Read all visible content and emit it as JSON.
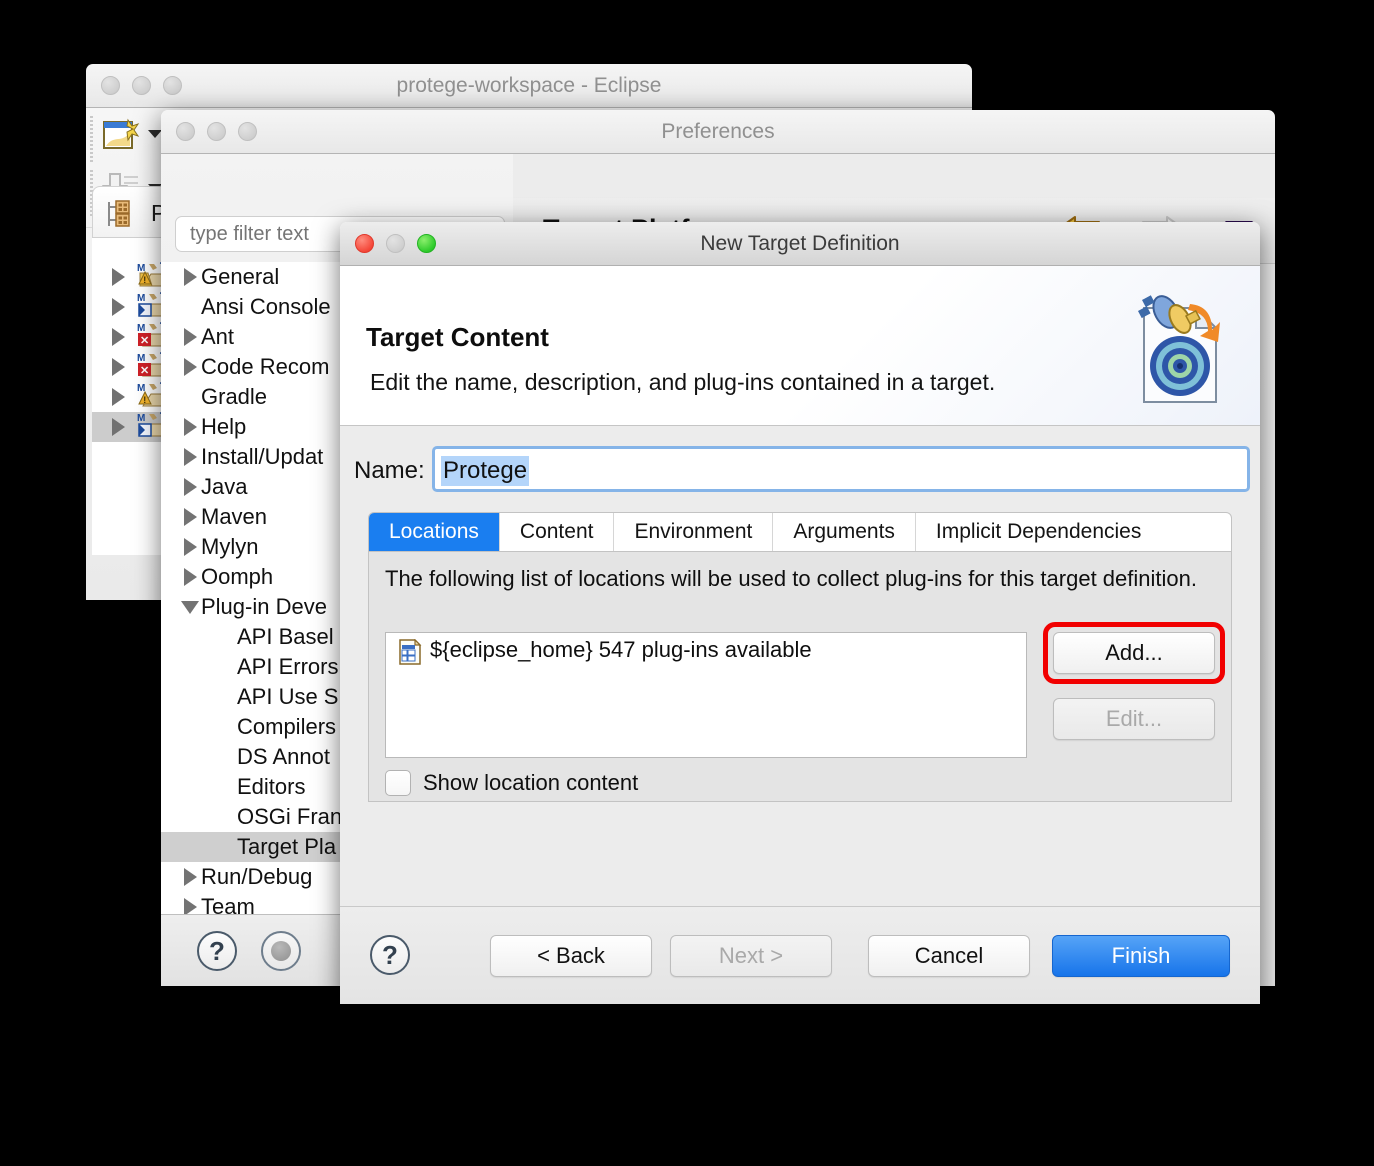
{
  "eclipse_window": {
    "title": "protege-workspace - Eclipse",
    "traffic_lights": [
      "close-gray",
      "minimize-gray",
      "zoom-gray"
    ],
    "toolbar": {
      "new_wizard_icon": "new-wizard-icon",
      "new_wizard_caret": "▼",
      "save_icon": "save-icon",
      "save_caret": "▼"
    },
    "package_explorer": {
      "tab_label": "Pa",
      "tab_icon": "package-explorer-icon",
      "rows": [
        {
          "expander": "▶",
          "icon": "maven-project-warning-icon",
          "selected": false
        },
        {
          "expander": "▶",
          "icon": "maven-project-icon",
          "selected": false
        },
        {
          "expander": "▶",
          "icon": "maven-project-error-icon",
          "selected": false
        },
        {
          "expander": "▶",
          "icon": "maven-project-error-icon",
          "selected": false
        },
        {
          "expander": "▶",
          "icon": "maven-project-warning-icon",
          "selected": false
        },
        {
          "expander": "▶",
          "icon": "maven-project-icon",
          "selected": true
        }
      ]
    }
  },
  "preferences_window": {
    "title": "Preferences",
    "traffic_lights": [
      "close-gray",
      "minimize-gray",
      "zoom-gray"
    ],
    "filter": {
      "placeholder": "type filter text",
      "value": ""
    },
    "tree_items": [
      {
        "label": "General",
        "arrow": "collapsed",
        "indent": 0,
        "selected": false
      },
      {
        "label": "Ansi Console",
        "arrow": "none",
        "indent": 0,
        "selected": false
      },
      {
        "label": "Ant",
        "arrow": "collapsed",
        "indent": 0,
        "selected": false
      },
      {
        "label": "Code Recom",
        "arrow": "collapsed",
        "indent": 0,
        "selected": false
      },
      {
        "label": "Gradle",
        "arrow": "none",
        "indent": 0,
        "selected": false
      },
      {
        "label": "Help",
        "arrow": "collapsed",
        "indent": 0,
        "selected": false
      },
      {
        "label": "Install/Updat",
        "arrow": "collapsed",
        "indent": 0,
        "selected": false
      },
      {
        "label": "Java",
        "arrow": "collapsed",
        "indent": 0,
        "selected": false
      },
      {
        "label": "Maven",
        "arrow": "collapsed",
        "indent": 0,
        "selected": false
      },
      {
        "label": "Mylyn",
        "arrow": "collapsed",
        "indent": 0,
        "selected": false
      },
      {
        "label": "Oomph",
        "arrow": "collapsed",
        "indent": 0,
        "selected": false
      },
      {
        "label": "Plug-in Deve",
        "arrow": "expanded",
        "indent": 0,
        "selected": false
      },
      {
        "label": "API Basel",
        "arrow": "none",
        "indent": 1,
        "selected": false
      },
      {
        "label": "API Errors",
        "arrow": "none",
        "indent": 1,
        "selected": false
      },
      {
        "label": "API Use S",
        "arrow": "none",
        "indent": 1,
        "selected": false
      },
      {
        "label": "Compilers",
        "arrow": "none",
        "indent": 1,
        "selected": false
      },
      {
        "label": "DS Annot",
        "arrow": "none",
        "indent": 1,
        "selected": false
      },
      {
        "label": "Editors",
        "arrow": "none",
        "indent": 1,
        "selected": false
      },
      {
        "label": "OSGi Fran",
        "arrow": "none",
        "indent": 1,
        "selected": false
      },
      {
        "label": "Target Pla",
        "arrow": "none",
        "indent": 1,
        "selected": true
      },
      {
        "label": "Run/Debug",
        "arrow": "collapsed",
        "indent": 0,
        "selected": false
      },
      {
        "label": "Team",
        "arrow": "collapsed",
        "indent": 0,
        "selected": false
      }
    ],
    "page_title": "Target Platform",
    "nav": {
      "back_icon": "back-arrow-icon",
      "back_caret": "▼",
      "forward_icon": "forward-arrow-icon",
      "forward_caret": "▼",
      "menu_caret": "▼"
    },
    "footer": {
      "help_icon": "help-question-icon",
      "record_icon": "record-circle-icon"
    }
  },
  "new_target_definition": {
    "title": "New Target Definition",
    "traffic_lights": [
      "close-red",
      "minimize-gray",
      "zoom-green"
    ],
    "header": {
      "heading": "Target Content",
      "subheading": "Edit the name, description, and plug-ins contained in a target.",
      "icon": "target-definition-icon"
    },
    "name": {
      "label": "Name:",
      "value": "Protege",
      "selected": true
    },
    "tabs": [
      {
        "label": "Locations",
        "active": true
      },
      {
        "label": "Content",
        "active": false
      },
      {
        "label": "Environment",
        "active": false
      },
      {
        "label": "Arguments",
        "active": false
      },
      {
        "label": "Implicit Dependencies",
        "active": false
      }
    ],
    "locations_panel": {
      "description": "The following list of locations will be used to collect plug-ins for this target definition.",
      "items": [
        {
          "icon": "eclipse-home-location-icon",
          "label": "${eclipse_home} 547 plug-ins available"
        }
      ],
      "add_button": "Add...",
      "edit_button": "Edit...",
      "edit_disabled": true,
      "highlight_color": "#f10000",
      "checkbox": {
        "label": "Show location content",
        "checked": false
      }
    },
    "footer": {
      "help_icon": "help-question-icon",
      "back_button": "< Back",
      "next_button": "Next >",
      "next_disabled": true,
      "cancel_button": "Cancel",
      "finish_button": "Finish",
      "finish_accent": "#1774ea"
    }
  }
}
